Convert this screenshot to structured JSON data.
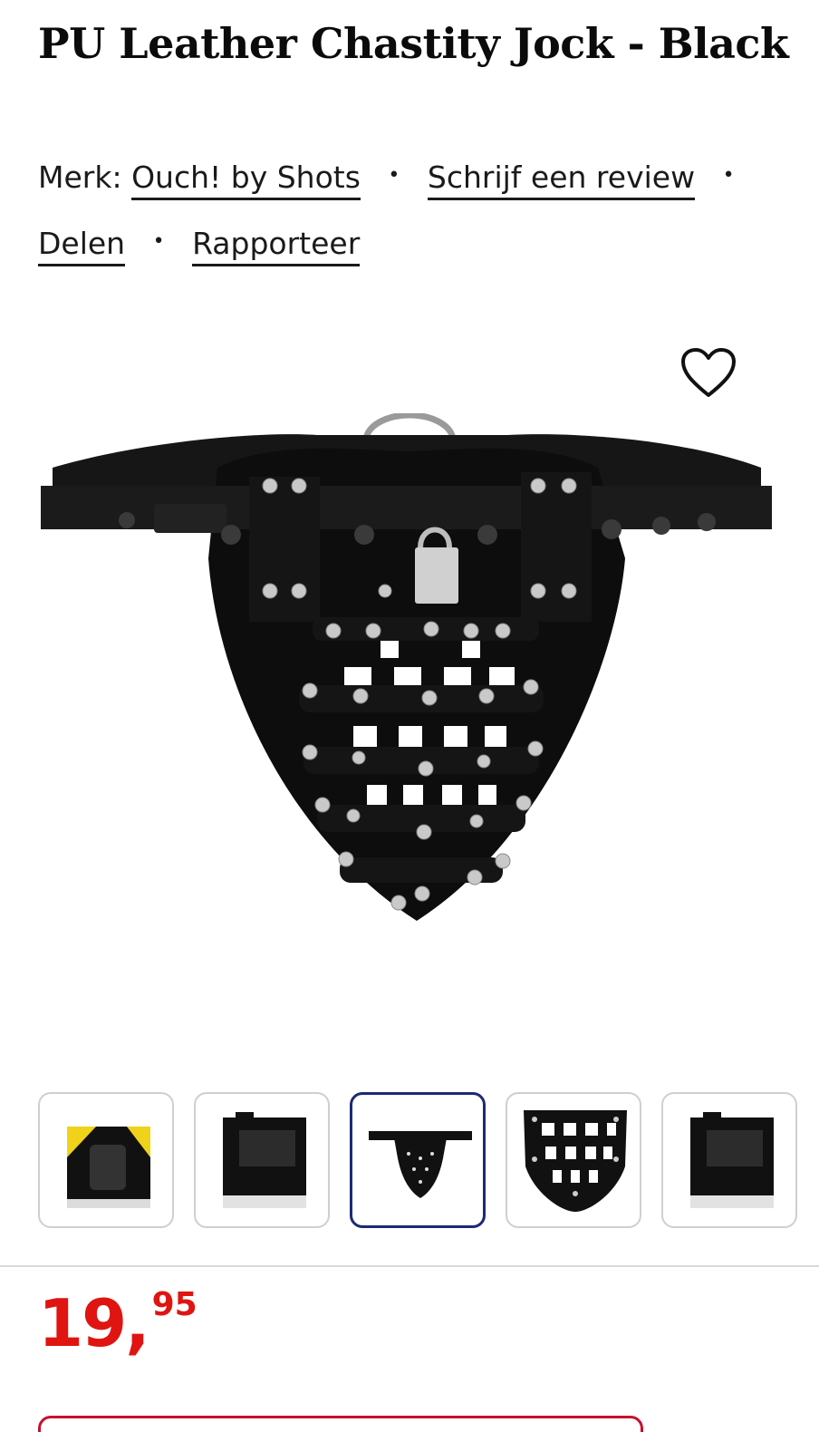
{
  "product": {
    "title": "PU Leather Chastity Jock - Black"
  },
  "meta": {
    "brand_prefix": "Merk:",
    "brand_link": "Ouch! by Shots",
    "review_link": "Schrijf een review",
    "share_link": "Delen",
    "report_link": "Rapporteer",
    "separator": "•"
  },
  "gallery": {
    "favorite_icon": "heart-outline-icon",
    "thumbnails": [
      {
        "label": "packaging-front"
      },
      {
        "label": "packaging-back"
      },
      {
        "label": "product-front",
        "active": true
      },
      {
        "label": "cage-closeup"
      },
      {
        "label": "packaging-back-2"
      }
    ]
  },
  "price": {
    "integer": "19",
    "separator": ",",
    "decimal": "95"
  },
  "colors": {
    "price": "#e01410",
    "active_thumb_border": "#1c2a78",
    "text": "#0a0a0a"
  }
}
